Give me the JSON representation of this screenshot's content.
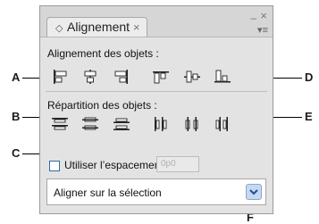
{
  "panel": {
    "tab_title": "Alignement",
    "tab_icon": "diamond-icon",
    "tab_close": "×",
    "window_min": "–",
    "window_close": "×",
    "menu_icon": "▾≡"
  },
  "align": {
    "label": "Alignement des objets :",
    "icons": [
      "align-left-icon",
      "align-horizontal-center-icon",
      "align-right-icon",
      "align-top-icon",
      "align-vertical-center-icon",
      "align-bottom-icon"
    ]
  },
  "distribute": {
    "label": "Répartition des objets :",
    "icons": [
      "distribute-top-icon",
      "distribute-vertical-center-icon",
      "distribute-bottom-icon",
      "distribute-left-icon",
      "distribute-horizontal-center-icon",
      "distribute-right-icon"
    ]
  },
  "spacing": {
    "checkbox_label": "Utiliser l’espacement",
    "checked": false,
    "value": "0p0"
  },
  "align_to": {
    "selected": "Aligner sur la sélection"
  },
  "callouts": [
    "A",
    "B",
    "C",
    "D",
    "E",
    "F"
  ],
  "colors": {
    "accent": "#3468a8",
    "panel_bg": "#e3e3e3"
  }
}
